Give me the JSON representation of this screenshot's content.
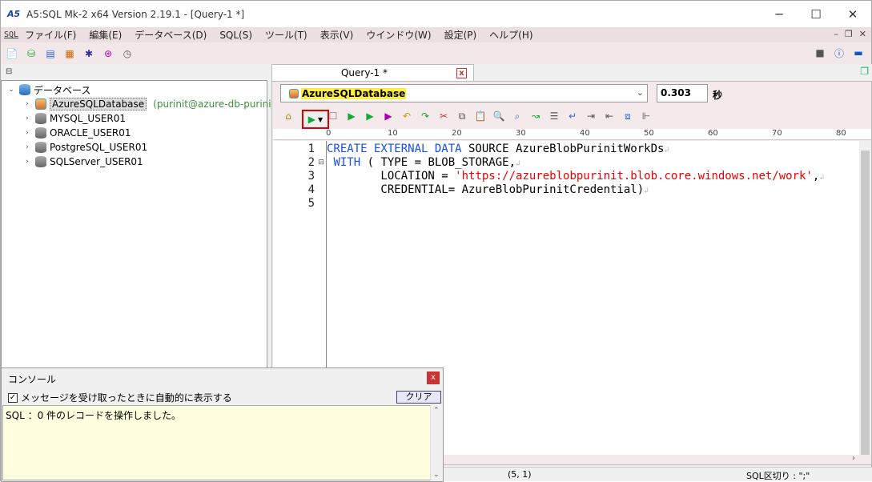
{
  "window": {
    "title": "A5:SQL Mk-2 x64 Version 2.19.1 - [Query-1 *]",
    "app_icon": "A5"
  },
  "menu": {
    "sql_badge": "SQL",
    "items": [
      "ファイル(F)",
      "編集(E)",
      "データベース(D)",
      "SQL(S)",
      "ツール(T)",
      "表示(V)",
      "ウインドウ(W)",
      "設定(P)",
      "ヘルプ(H)"
    ]
  },
  "tree": {
    "root_label": "データベース",
    "nodes": [
      {
        "label": "AzureSQLDatabase",
        "info": "(purinit@azure-db-purinit)",
        "selected": true
      },
      {
        "label": "MYSQL_USER01"
      },
      {
        "label": "ORACLE_USER01"
      },
      {
        "label": "PostgreSQL_USER01"
      },
      {
        "label": "SQLServer_USER01"
      }
    ]
  },
  "tab": {
    "title": "Query-1 *",
    "close": "x"
  },
  "editor": {
    "db_select": "AzureSQLDatabase",
    "elapsed": "0.303",
    "elapsed_unit": "秒",
    "ruler": [
      "0",
      "10",
      "20",
      "30",
      "40",
      "50",
      "60",
      "70",
      "80"
    ],
    "line_numbers": [
      "1",
      "2",
      "3",
      "4",
      "5"
    ]
  },
  "status": {
    "position": "(5, 1)",
    "sql_delim": "SQL区切り : \";\""
  },
  "console": {
    "title": "コンソール",
    "auto_show_label": "メッセージを受け取ったときに自動的に表示する",
    "clear_label": "クリア",
    "output": "SQL ：0 件のレコードを操作しました。"
  },
  "colors": {
    "accent_red": "#e00000",
    "keyword_blue": "#1a4fe0",
    "string_red": "#e00000"
  }
}
